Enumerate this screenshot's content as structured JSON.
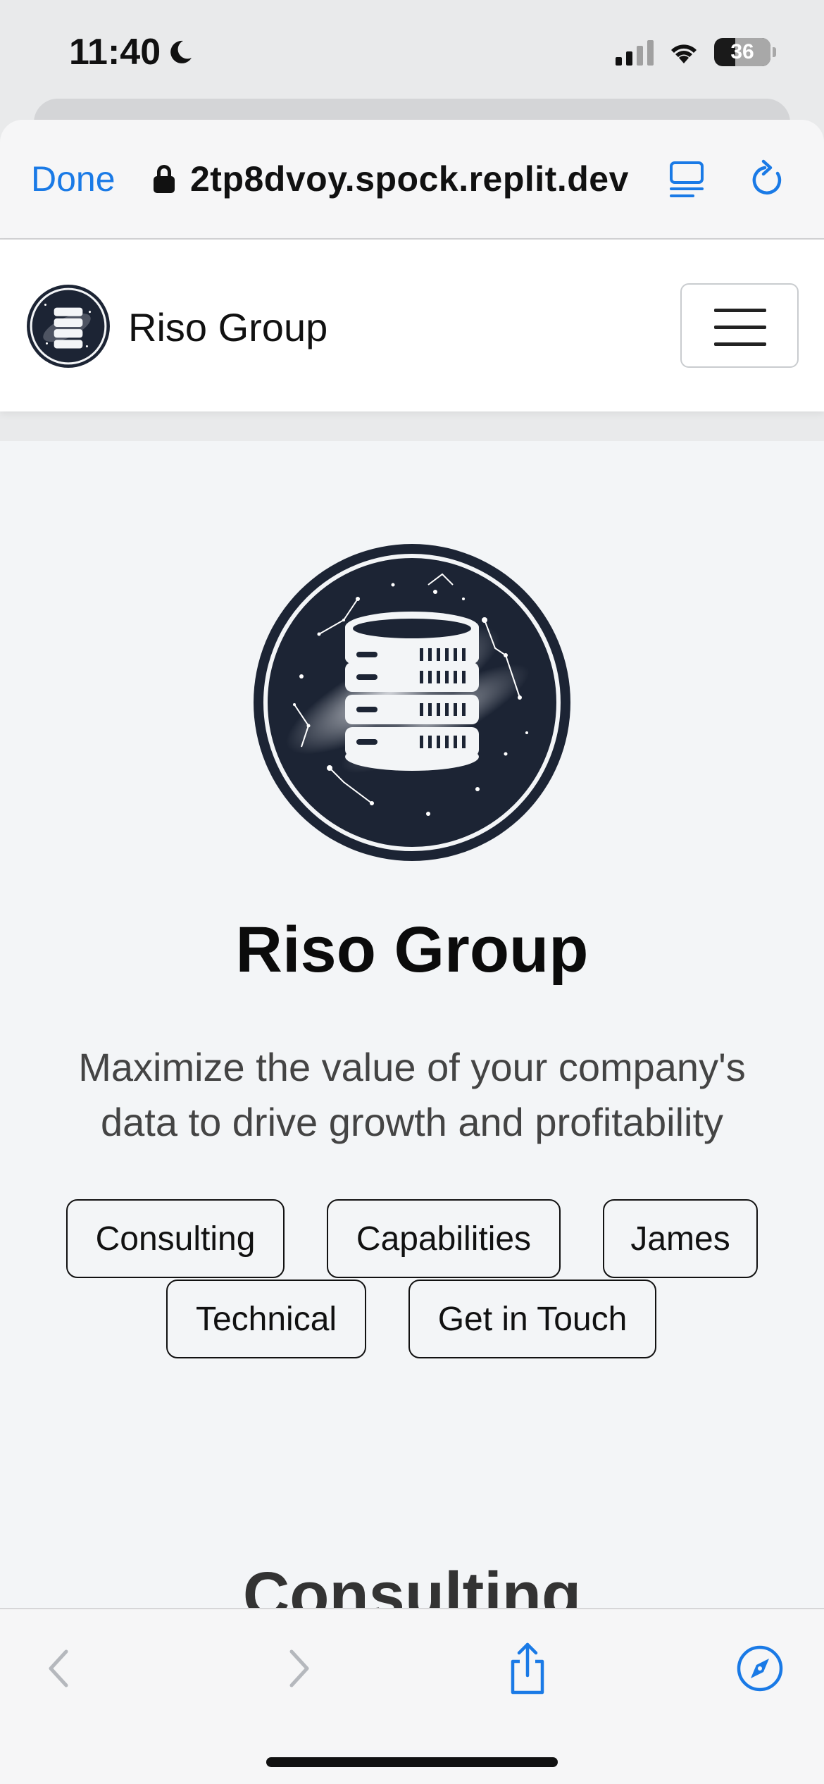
{
  "status_bar": {
    "time": "11:40",
    "battery": "36"
  },
  "browser": {
    "done_label": "Done",
    "url": "2tp8dvoy.spock.replit.dev"
  },
  "navbar": {
    "brand": "Riso Group"
  },
  "hero": {
    "title": "Riso Group",
    "subtitle": "Maximize the value of your company's data to drive growth and profitability",
    "buttons": [
      "Consulting",
      "Capabilities",
      "James",
      "Technical",
      "Get in Touch"
    ]
  },
  "next_section": {
    "title": "Consulting"
  },
  "colors": {
    "accent": "#1a7ae6",
    "logo_dark": "#1c2434"
  }
}
